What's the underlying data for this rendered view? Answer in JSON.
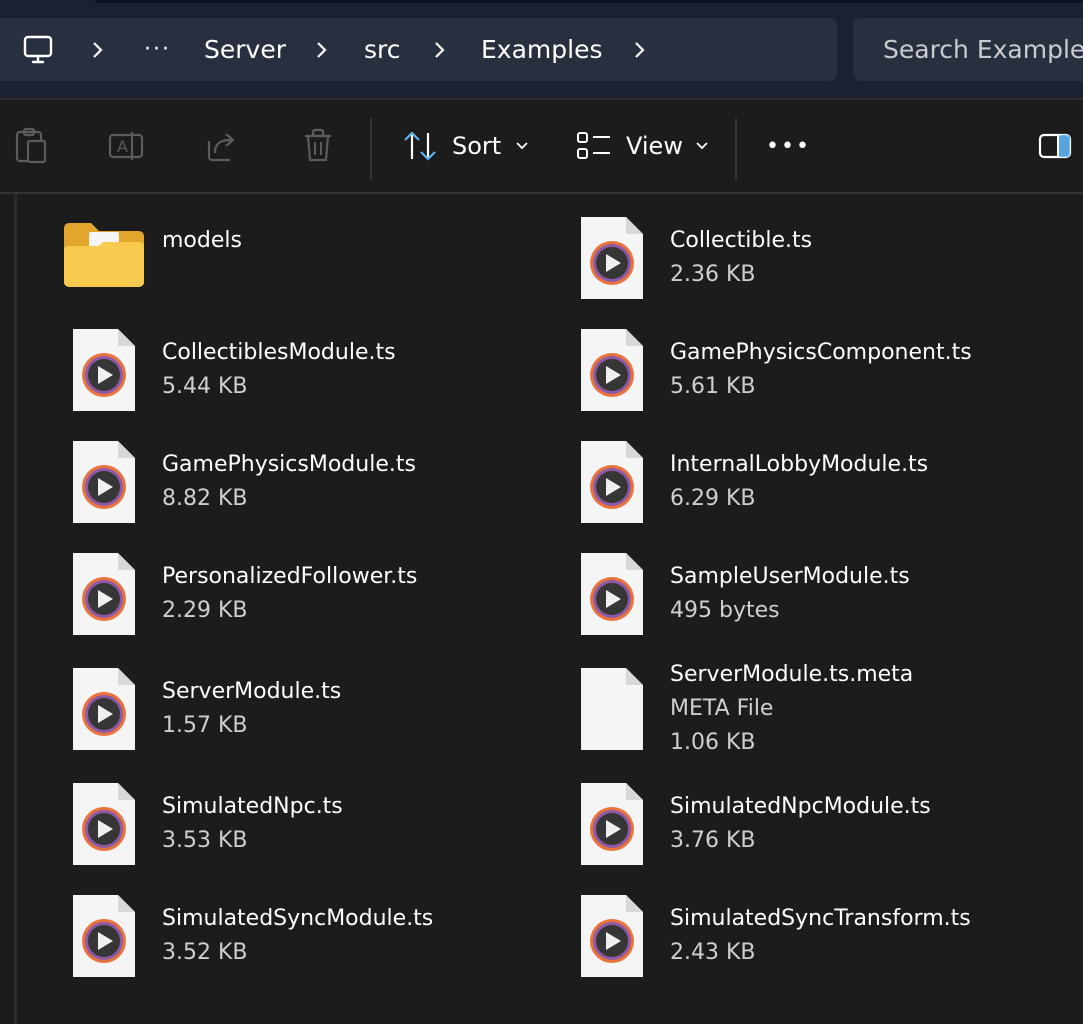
{
  "breadcrumb": {
    "items": [
      "Server",
      "src",
      "Examples"
    ],
    "overflow_label": "···"
  },
  "search": {
    "placeholder": "Search Examples"
  },
  "toolbar": {
    "sort_label": "Sort",
    "view_label": "View",
    "more_label": "•••"
  },
  "files": [
    {
      "name": "models",
      "meta": [],
      "kind": "folder"
    },
    {
      "name": "Collectible.ts",
      "meta": [
        "2.36 KB"
      ],
      "kind": "ts"
    },
    {
      "name": "CollectiblesModule.ts",
      "meta": [
        "5.44 KB"
      ],
      "kind": "ts"
    },
    {
      "name": "GamePhysicsComponent.ts",
      "meta": [
        "5.61 KB"
      ],
      "kind": "ts"
    },
    {
      "name": "GamePhysicsModule.ts",
      "meta": [
        "8.82 KB"
      ],
      "kind": "ts"
    },
    {
      "name": "InternalLobbyModule.ts",
      "meta": [
        "6.29 KB"
      ],
      "kind": "ts"
    },
    {
      "name": "PersonalizedFollower.ts",
      "meta": [
        "2.29 KB"
      ],
      "kind": "ts"
    },
    {
      "name": "SampleUserModule.ts",
      "meta": [
        "495 bytes"
      ],
      "kind": "ts"
    },
    {
      "name": "ServerModule.ts",
      "meta": [
        "1.57 KB"
      ],
      "kind": "ts"
    },
    {
      "name": "ServerModule.ts.meta",
      "meta": [
        "META File",
        "1.06 KB"
      ],
      "kind": "blank"
    },
    {
      "name": "SimulatedNpc.ts",
      "meta": [
        "3.53 KB"
      ],
      "kind": "ts"
    },
    {
      "name": "SimulatedNpcModule.ts",
      "meta": [
        "3.76 KB"
      ],
      "kind": "ts"
    },
    {
      "name": "SimulatedSyncModule.ts",
      "meta": [
        "3.52 KB"
      ],
      "kind": "ts"
    },
    {
      "name": "SimulatedSyncTransform.ts",
      "meta": [
        "2.43 KB"
      ],
      "kind": "ts"
    }
  ],
  "colors": {
    "background": "#1c1c1c",
    "address_bar": "#1b2130",
    "crumb_box": "#283040",
    "folder": "#f6c244",
    "ts_ring": "#e8743c",
    "ts_play": "#3a3a3a"
  }
}
